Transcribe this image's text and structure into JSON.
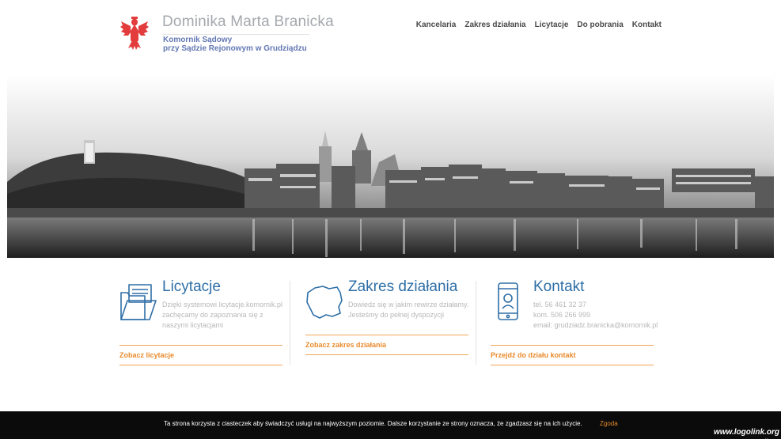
{
  "header": {
    "name": "Dominika Marta Branicka",
    "subtitle_line1": "Komornik Sądowy",
    "subtitle_line2": "przy Sądzie Rejonowym w Grudziądzu",
    "logo_icon": "polish-eagle-emblem",
    "accent_color": "#6378b4"
  },
  "nav": {
    "items": [
      "Kancelaria",
      "Zakres działania",
      "Licytacje",
      "Do pobrania",
      "Kontakt"
    ]
  },
  "hero": {
    "description_icon": "city-panorama-photo"
  },
  "features": [
    {
      "icon": "folder-documents-icon",
      "title": "Licytacje",
      "desc": "Dzięki systemowi licytacje.komornik.pl zachęcamy do zapoznania się z naszymi licytacjami",
      "link": "Zobacz licytacje"
    },
    {
      "icon": "poland-map-icon",
      "title": "Zakres działania",
      "desc": "Dowiedz się w jakim rewirze działamy. Jesteśmy do pełnej dyspozycji",
      "link": "Zobacz zakres działania"
    },
    {
      "icon": "phone-contact-icon",
      "title": "Kontakt",
      "desc_lines": [
        "tel. 56 461 32 37",
        "kom. 506 266 999",
        "email: grudziadz.branicka@komornik.pl"
      ],
      "link": "Przejdź do działu kontakt"
    }
  ],
  "cookie": {
    "text": "Ta strona korzysta z ciasteczek aby świadczyć usługi na najwyższym poziomie. Dalsze korzystanie ze strony oznacza, że zgadzasz się na ich użycie.",
    "accept": "Zgoda",
    "close": "×"
  },
  "watermark": "www.logolink.org",
  "colors": {
    "title_blue": "#2e6fa7",
    "link_orange": "#e98a2b",
    "eagle_red": "#e23c3c"
  }
}
